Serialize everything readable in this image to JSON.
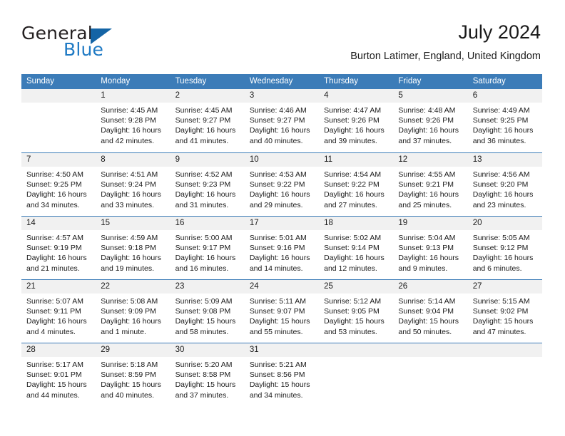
{
  "logo": {
    "primary_text": "General",
    "secondary_text": "Blue",
    "accent_color": "#1464a5",
    "secondary_color": "#1f7ac4"
  },
  "header": {
    "title": "July 2024",
    "location": "Burton Latimer, England, United Kingdom"
  },
  "calendar": {
    "header_color": "#3c7cb8",
    "day_band_color": "#f1f1f1",
    "weekdays": [
      "Sunday",
      "Monday",
      "Tuesday",
      "Wednesday",
      "Thursday",
      "Friday",
      "Saturday"
    ],
    "weeks": [
      [
        {
          "day": "",
          "empty": true,
          "sunrise": "",
          "sunset": "",
          "daylight_line1": "",
          "daylight_line2": ""
        },
        {
          "day": "1",
          "sunrise": "Sunrise: 4:45 AM",
          "sunset": "Sunset: 9:28 PM",
          "daylight_line1": "Daylight: 16 hours",
          "daylight_line2": "and 42 minutes."
        },
        {
          "day": "2",
          "sunrise": "Sunrise: 4:45 AM",
          "sunset": "Sunset: 9:27 PM",
          "daylight_line1": "Daylight: 16 hours",
          "daylight_line2": "and 41 minutes."
        },
        {
          "day": "3",
          "sunrise": "Sunrise: 4:46 AM",
          "sunset": "Sunset: 9:27 PM",
          "daylight_line1": "Daylight: 16 hours",
          "daylight_line2": "and 40 minutes."
        },
        {
          "day": "4",
          "sunrise": "Sunrise: 4:47 AM",
          "sunset": "Sunset: 9:26 PM",
          "daylight_line1": "Daylight: 16 hours",
          "daylight_line2": "and 39 minutes."
        },
        {
          "day": "5",
          "sunrise": "Sunrise: 4:48 AM",
          "sunset": "Sunset: 9:26 PM",
          "daylight_line1": "Daylight: 16 hours",
          "daylight_line2": "and 37 minutes."
        },
        {
          "day": "6",
          "sunrise": "Sunrise: 4:49 AM",
          "sunset": "Sunset: 9:25 PM",
          "daylight_line1": "Daylight: 16 hours",
          "daylight_line2": "and 36 minutes."
        }
      ],
      [
        {
          "day": "7",
          "sunrise": "Sunrise: 4:50 AM",
          "sunset": "Sunset: 9:25 PM",
          "daylight_line1": "Daylight: 16 hours",
          "daylight_line2": "and 34 minutes."
        },
        {
          "day": "8",
          "sunrise": "Sunrise: 4:51 AM",
          "sunset": "Sunset: 9:24 PM",
          "daylight_line1": "Daylight: 16 hours",
          "daylight_line2": "and 33 minutes."
        },
        {
          "day": "9",
          "sunrise": "Sunrise: 4:52 AM",
          "sunset": "Sunset: 9:23 PM",
          "daylight_line1": "Daylight: 16 hours",
          "daylight_line2": "and 31 minutes."
        },
        {
          "day": "10",
          "sunrise": "Sunrise: 4:53 AM",
          "sunset": "Sunset: 9:22 PM",
          "daylight_line1": "Daylight: 16 hours",
          "daylight_line2": "and 29 minutes."
        },
        {
          "day": "11",
          "sunrise": "Sunrise: 4:54 AM",
          "sunset": "Sunset: 9:22 PM",
          "daylight_line1": "Daylight: 16 hours",
          "daylight_line2": "and 27 minutes."
        },
        {
          "day": "12",
          "sunrise": "Sunrise: 4:55 AM",
          "sunset": "Sunset: 9:21 PM",
          "daylight_line1": "Daylight: 16 hours",
          "daylight_line2": "and 25 minutes."
        },
        {
          "day": "13",
          "sunrise": "Sunrise: 4:56 AM",
          "sunset": "Sunset: 9:20 PM",
          "daylight_line1": "Daylight: 16 hours",
          "daylight_line2": "and 23 minutes."
        }
      ],
      [
        {
          "day": "14",
          "sunrise": "Sunrise: 4:57 AM",
          "sunset": "Sunset: 9:19 PM",
          "daylight_line1": "Daylight: 16 hours",
          "daylight_line2": "and 21 minutes."
        },
        {
          "day": "15",
          "sunrise": "Sunrise: 4:59 AM",
          "sunset": "Sunset: 9:18 PM",
          "daylight_line1": "Daylight: 16 hours",
          "daylight_line2": "and 19 minutes."
        },
        {
          "day": "16",
          "sunrise": "Sunrise: 5:00 AM",
          "sunset": "Sunset: 9:17 PM",
          "daylight_line1": "Daylight: 16 hours",
          "daylight_line2": "and 16 minutes."
        },
        {
          "day": "17",
          "sunrise": "Sunrise: 5:01 AM",
          "sunset": "Sunset: 9:16 PM",
          "daylight_line1": "Daylight: 16 hours",
          "daylight_line2": "and 14 minutes."
        },
        {
          "day": "18",
          "sunrise": "Sunrise: 5:02 AM",
          "sunset": "Sunset: 9:14 PM",
          "daylight_line1": "Daylight: 16 hours",
          "daylight_line2": "and 12 minutes."
        },
        {
          "day": "19",
          "sunrise": "Sunrise: 5:04 AM",
          "sunset": "Sunset: 9:13 PM",
          "daylight_line1": "Daylight: 16 hours",
          "daylight_line2": "and 9 minutes."
        },
        {
          "day": "20",
          "sunrise": "Sunrise: 5:05 AM",
          "sunset": "Sunset: 9:12 PM",
          "daylight_line1": "Daylight: 16 hours",
          "daylight_line2": "and 6 minutes."
        }
      ],
      [
        {
          "day": "21",
          "sunrise": "Sunrise: 5:07 AM",
          "sunset": "Sunset: 9:11 PM",
          "daylight_line1": "Daylight: 16 hours",
          "daylight_line2": "and 4 minutes."
        },
        {
          "day": "22",
          "sunrise": "Sunrise: 5:08 AM",
          "sunset": "Sunset: 9:09 PM",
          "daylight_line1": "Daylight: 16 hours",
          "daylight_line2": "and 1 minute."
        },
        {
          "day": "23",
          "sunrise": "Sunrise: 5:09 AM",
          "sunset": "Sunset: 9:08 PM",
          "daylight_line1": "Daylight: 15 hours",
          "daylight_line2": "and 58 minutes."
        },
        {
          "day": "24",
          "sunrise": "Sunrise: 5:11 AM",
          "sunset": "Sunset: 9:07 PM",
          "daylight_line1": "Daylight: 15 hours",
          "daylight_line2": "and 55 minutes."
        },
        {
          "day": "25",
          "sunrise": "Sunrise: 5:12 AM",
          "sunset": "Sunset: 9:05 PM",
          "daylight_line1": "Daylight: 15 hours",
          "daylight_line2": "and 53 minutes."
        },
        {
          "day": "26",
          "sunrise": "Sunrise: 5:14 AM",
          "sunset": "Sunset: 9:04 PM",
          "daylight_line1": "Daylight: 15 hours",
          "daylight_line2": "and 50 minutes."
        },
        {
          "day": "27",
          "sunrise": "Sunrise: 5:15 AM",
          "sunset": "Sunset: 9:02 PM",
          "daylight_line1": "Daylight: 15 hours",
          "daylight_line2": "and 47 minutes."
        }
      ],
      [
        {
          "day": "28",
          "sunrise": "Sunrise: 5:17 AM",
          "sunset": "Sunset: 9:01 PM",
          "daylight_line1": "Daylight: 15 hours",
          "daylight_line2": "and 44 minutes."
        },
        {
          "day": "29",
          "sunrise": "Sunrise: 5:18 AM",
          "sunset": "Sunset: 8:59 PM",
          "daylight_line1": "Daylight: 15 hours",
          "daylight_line2": "and 40 minutes."
        },
        {
          "day": "30",
          "sunrise": "Sunrise: 5:20 AM",
          "sunset": "Sunset: 8:58 PM",
          "daylight_line1": "Daylight: 15 hours",
          "daylight_line2": "and 37 minutes."
        },
        {
          "day": "31",
          "sunrise": "Sunrise: 5:21 AM",
          "sunset": "Sunset: 8:56 PM",
          "daylight_line1": "Daylight: 15 hours",
          "daylight_line2": "and 34 minutes."
        },
        {
          "day": "",
          "empty": true,
          "sunrise": "",
          "sunset": "",
          "daylight_line1": "",
          "daylight_line2": ""
        },
        {
          "day": "",
          "empty": true,
          "sunrise": "",
          "sunset": "",
          "daylight_line1": "",
          "daylight_line2": ""
        },
        {
          "day": "",
          "empty": true,
          "sunrise": "",
          "sunset": "",
          "daylight_line1": "",
          "daylight_line2": ""
        }
      ]
    ]
  }
}
